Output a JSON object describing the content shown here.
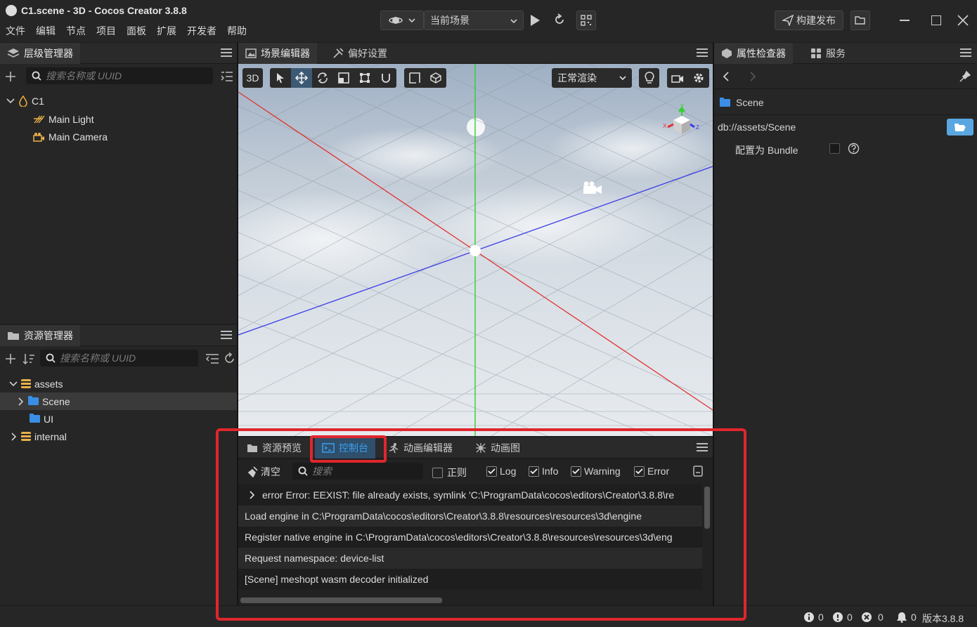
{
  "window": {
    "title": "C1.scene - 3D - Cocos Creator 3.8.8",
    "menu": [
      "文件",
      "编辑",
      "节点",
      "项目",
      "面板",
      "扩展",
      "开发者",
      "帮助"
    ],
    "scene_select": "当前场景",
    "build_button": "构建发布"
  },
  "hierarchy": {
    "tab": "层级管理器",
    "search_placeholder": "搜索名称或 UUID",
    "root": "C1",
    "children": [
      "Main Light",
      "Main Camera"
    ]
  },
  "assets": {
    "tab": "资源管理器",
    "search_placeholder": "搜索名称或 UUID",
    "items": [
      {
        "label": "assets",
        "icon": "database-icon"
      },
      {
        "label": "Scene",
        "icon": "folder-icon"
      },
      {
        "label": "UI",
        "icon": "folder-icon"
      },
      {
        "label": "internal",
        "icon": "database-icon"
      }
    ]
  },
  "scene_editor": {
    "tabs": [
      "场景编辑器",
      "偏好设置"
    ],
    "mode_3d": "3D",
    "render_mode": "正常渲染",
    "gizmo_labels": {
      "y": "Y",
      "x": "X",
      "z": "Z"
    }
  },
  "bottom_panel": {
    "tabs": [
      "资源预览",
      "控制台",
      "动画编辑器",
      "动画图"
    ],
    "active_tab": "控制台",
    "clear_label": "清空",
    "search_placeholder": "搜索",
    "filters": [
      {
        "label": "正则",
        "checked": false
      },
      {
        "label": "Log",
        "checked": true
      },
      {
        "label": "Info",
        "checked": true
      },
      {
        "label": "Warning",
        "checked": true
      },
      {
        "label": "Error",
        "checked": true
      }
    ],
    "logs": [
      "error Error: EEXIST: file already exists, symlink 'C:\\ProgramData\\cocos\\editors\\Creator\\3.8.8\\re",
      "Load engine in C:\\ProgramData\\cocos\\editors\\Creator\\3.8.8\\resources\\resources\\3d\\engine",
      "Register native engine in C:\\ProgramData\\cocos\\editors\\Creator\\3.8.8\\resources\\resources\\3d\\eng",
      "Request namespace: device-list",
      "[Scene] meshopt wasm decoder initialized"
    ]
  },
  "inspector": {
    "tabs": [
      "属性检查器",
      "服务"
    ],
    "node_name": "Scene",
    "path": "db://assets/Scene",
    "bundle_label": "配置为 Bundle",
    "bundle_checked": false
  },
  "statusbar": {
    "info_count": "0",
    "warn_count": "0",
    "error_count": "0",
    "notify_count": "0",
    "version": "版本3.8.8"
  },
  "colors": {
    "accent": "#3a8ee6",
    "highlight": "#e0262d",
    "axis_x": "#e23232",
    "axis_y": "#2fd12f",
    "axis_z": "#3b3be8"
  }
}
